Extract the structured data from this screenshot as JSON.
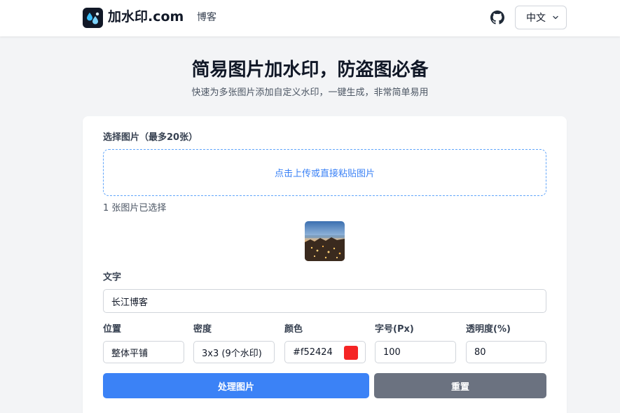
{
  "header": {
    "brand": "加水印.com",
    "nav_blog": "博客",
    "language": "中文"
  },
  "hero": {
    "title": "简易图片加水印，防盗图必备",
    "subtitle": "快速为多张图片添加自定义水印，一键生成，非常简单易用"
  },
  "upload": {
    "label": "选择图片（最多20张）",
    "dropzone_text": "点击上传或直接粘贴图片",
    "selected_text": "1 张图片已选择"
  },
  "watermark_text": {
    "label": "文字",
    "value": "长江博客"
  },
  "options": {
    "position_label": "位置",
    "position_value": "整体平铺",
    "density_label": "密度",
    "density_value": "3x3 (9个水印)",
    "color_label": "颜色",
    "color_value": "#f52424",
    "fontsize_label": "字号(Px)",
    "fontsize_value": "100",
    "opacity_label": "透明度(%)",
    "opacity_value": "80"
  },
  "actions": {
    "process": "处理图片",
    "reset": "重置"
  },
  "colors": {
    "accent": "#3b82f6",
    "secondary": "#6b7280",
    "watermark": "#f52424"
  },
  "icons": {
    "logo": "water-drops-icon",
    "github": "github-icon",
    "language_chevron": "chevron-down-icon"
  }
}
